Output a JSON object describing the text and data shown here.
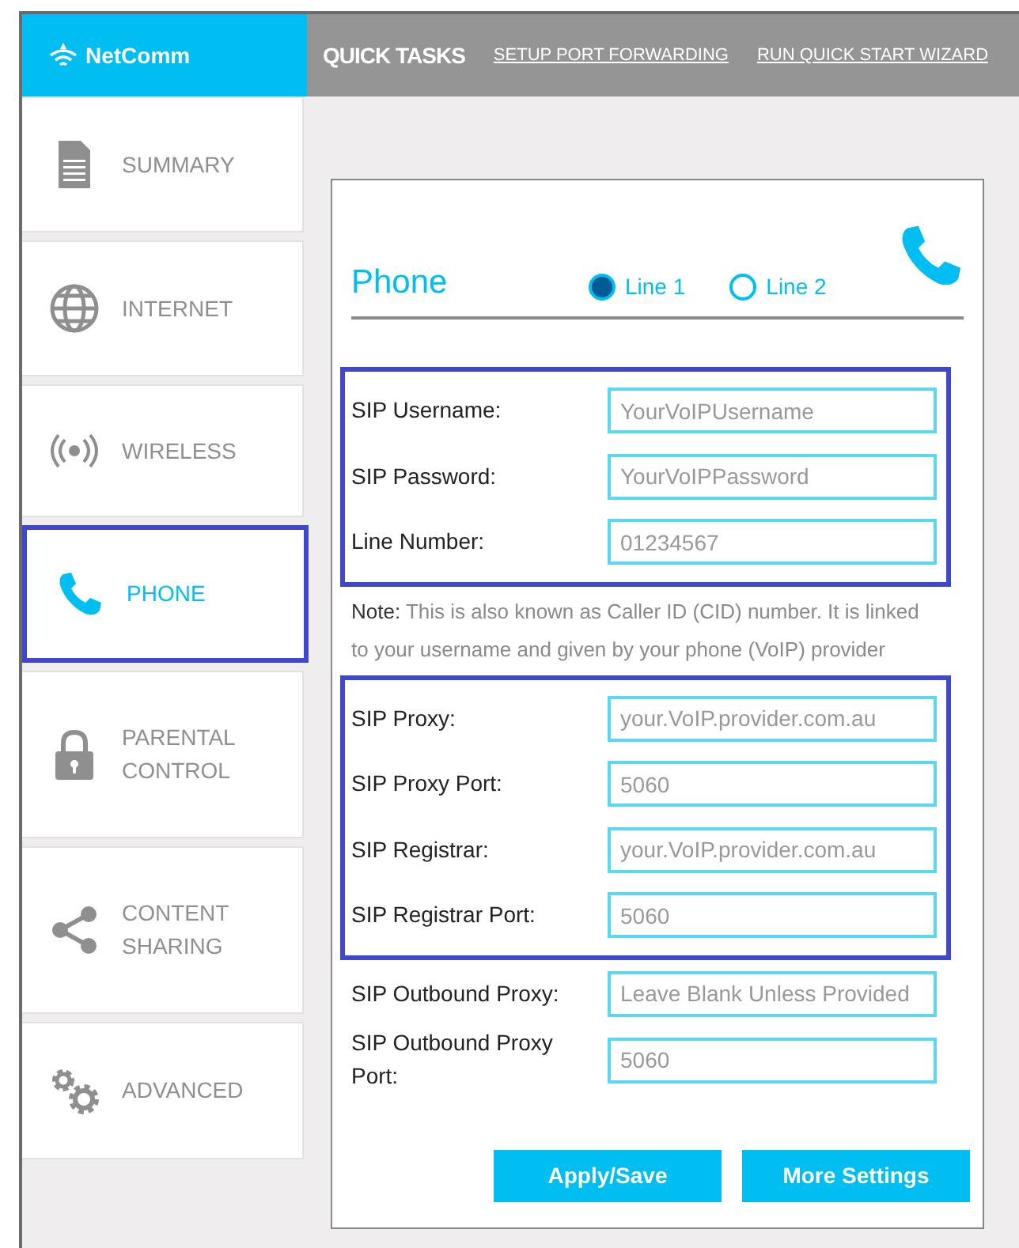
{
  "brand": {
    "name": "NetComm"
  },
  "quick_tasks": {
    "title": "QUICK TASKS",
    "links": [
      "SETUP PORT FORWARDING",
      "RUN QUICK START WIZARD"
    ]
  },
  "sidebar": {
    "items": [
      {
        "label": "SUMMARY",
        "kind": "document",
        "selected": false
      },
      {
        "label": "INTERNET",
        "kind": "globe",
        "selected": false
      },
      {
        "label": "WIRELESS",
        "kind": "wireless",
        "selected": false
      },
      {
        "label": "PHONE",
        "kind": "phone",
        "selected": true
      },
      {
        "label": "PARENTAL CONTROL",
        "kind": "lock",
        "selected": false
      },
      {
        "label": "CONTENT SHARING",
        "kind": "share",
        "selected": false
      },
      {
        "label": "ADVANCED",
        "kind": "gears",
        "selected": false
      }
    ]
  },
  "panel": {
    "title": "Phone",
    "lines": [
      {
        "label": "Line 1",
        "selected": true
      },
      {
        "label": "Line 2",
        "selected": false
      }
    ],
    "groups": [
      {
        "highlighted": true,
        "fields": [
          {
            "label": "SIP Username:",
            "placeholder": "YourVoIPUsername"
          },
          {
            "label": "SIP Password:",
            "placeholder": "YourVoIPPassword"
          },
          {
            "label": "Line Number:",
            "placeholder": "01234567"
          }
        ]
      },
      {
        "highlighted": false,
        "note": "**Note:** This is also known as Caller ID (CID) number. It is linked to your username and given by your phone (VoIP) provider"
      },
      {
        "highlighted": true,
        "fields": [
          {
            "label": "SIP Proxy:",
            "placeholder": "your.VoIP.provider.com.au"
          },
          {
            "label": "SIP Proxy Port:",
            "placeholder": "5060"
          },
          {
            "label": "SIP Registrar:",
            "placeholder": "your.VoIP.provider.com.au"
          },
          {
            "label": "SIP Registrar Port:",
            "placeholder": "5060"
          }
        ]
      },
      {
        "highlighted": false,
        "fields": [
          {
            "label": "SIP Outbound Proxy:",
            "placeholder": "Leave Blank Unless Provided"
          },
          {
            "label": "SIP Outbound Proxy Port:",
            "placeholder": "5060"
          }
        ]
      }
    ],
    "buttons": [
      "Apply/Save",
      "More Settings"
    ]
  }
}
